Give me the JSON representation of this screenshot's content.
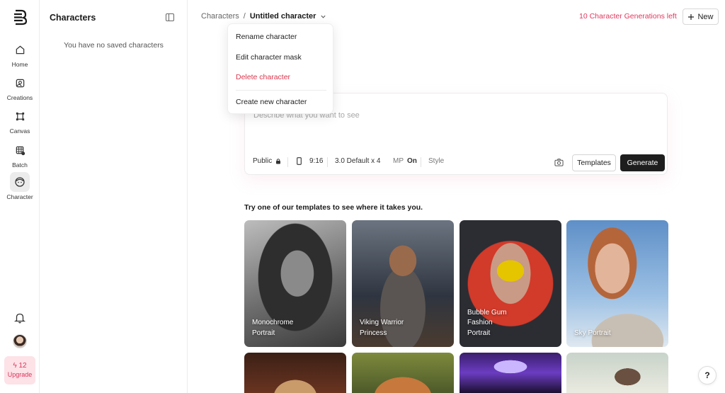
{
  "rail": {
    "items": [
      {
        "label": "Home",
        "icon": "home-icon"
      },
      {
        "label": "Creations",
        "icon": "image-icon"
      },
      {
        "label": "Canvas",
        "icon": "canvas-icon"
      },
      {
        "label": "Batch",
        "icon": "batch-icon"
      },
      {
        "label": "Character",
        "icon": "character-icon"
      }
    ],
    "upgrade": {
      "count": "12",
      "label": "Upgrade"
    }
  },
  "panel": {
    "title": "Characters",
    "empty": "You have no saved characters"
  },
  "header": {
    "crumb_root": "Characters",
    "crumb_sep": "/",
    "crumb_current": "Untitled character",
    "credits": "10 Character Generations left",
    "new_label": "New"
  },
  "menu": {
    "rename": "Rename character",
    "edit_mask": "Edit character mask",
    "delete": "Delete character",
    "create": "Create new character"
  },
  "prompt": {
    "placeholder": "Describe what you want to see",
    "visibility": "Public",
    "ratio": "9:16",
    "model": "3.0 Default x 4",
    "mp_label": "MP",
    "mp_value": "On",
    "style": "Style",
    "templates_label": "Templates",
    "generate_label": "Generate"
  },
  "templates": {
    "heading": "Try one of our templates to see where it takes you.",
    "cards": [
      {
        "line1": "Monochrome",
        "line2": "Portrait",
        "line3": ""
      },
      {
        "line1": "Viking Warrior",
        "line2": "Princess",
        "line3": ""
      },
      {
        "line1": "Bubble Gum",
        "line2": "Fashion",
        "line3": "Portrait"
      },
      {
        "line1": "Sky Portrait",
        "line2": "",
        "line3": ""
      }
    ]
  },
  "help": "?",
  "colors": {
    "accent": "#e0375d",
    "generate_bg": "#1e1e1e",
    "upgrade_bg": "#fde2e7"
  }
}
